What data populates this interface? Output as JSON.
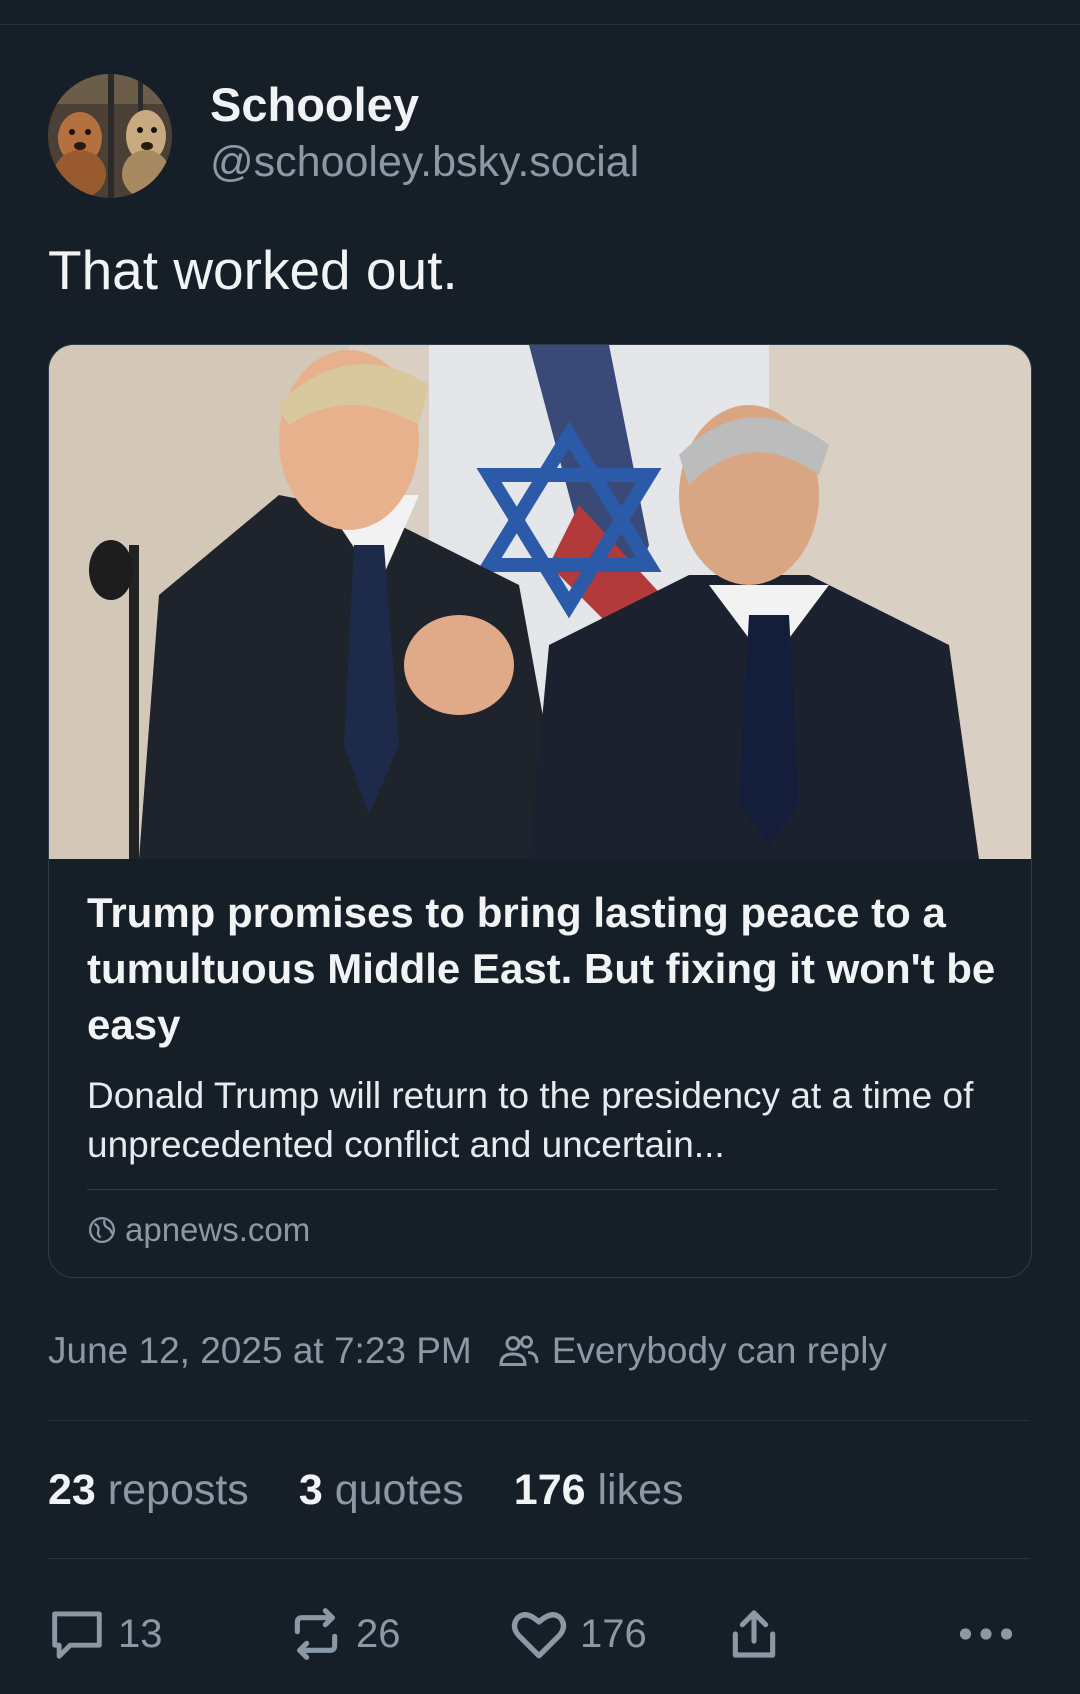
{
  "author": {
    "display_name": "Schooley",
    "handle": "@schooley.bsky.social",
    "avatar_icon": "avatar-two-dogs"
  },
  "post": {
    "text": "That worked out."
  },
  "link_card": {
    "image_icon": "news-photo-two-leaders-handshake",
    "title": "Trump promises to bring lasting peace to a tumultuous Middle East. But fixing it won't be easy",
    "description": "Donald Trump will return to the presidency at a time of unprecedented conflict and uncertain...",
    "domain": "apnews.com",
    "domain_icon": "globe-icon"
  },
  "meta": {
    "timestamp": "June 12, 2025 at 7:23 PM",
    "reply_setting": "Everybody can reply",
    "reply_setting_icon": "people-icon"
  },
  "stats": {
    "reposts_count": "23",
    "reposts_label": "reposts",
    "quotes_count": "3",
    "quotes_label": "quotes",
    "likes_count": "176",
    "likes_label": "likes"
  },
  "actions": {
    "reply_count": "13",
    "repost_count": "26",
    "like_count": "176",
    "share_icon": "share-icon",
    "more_icon": "more-icon"
  },
  "colors": {
    "background": "#161e27",
    "text_primary": "#f1f3f5",
    "text_secondary": "#8b98a5",
    "border": "#2e3c4c"
  }
}
